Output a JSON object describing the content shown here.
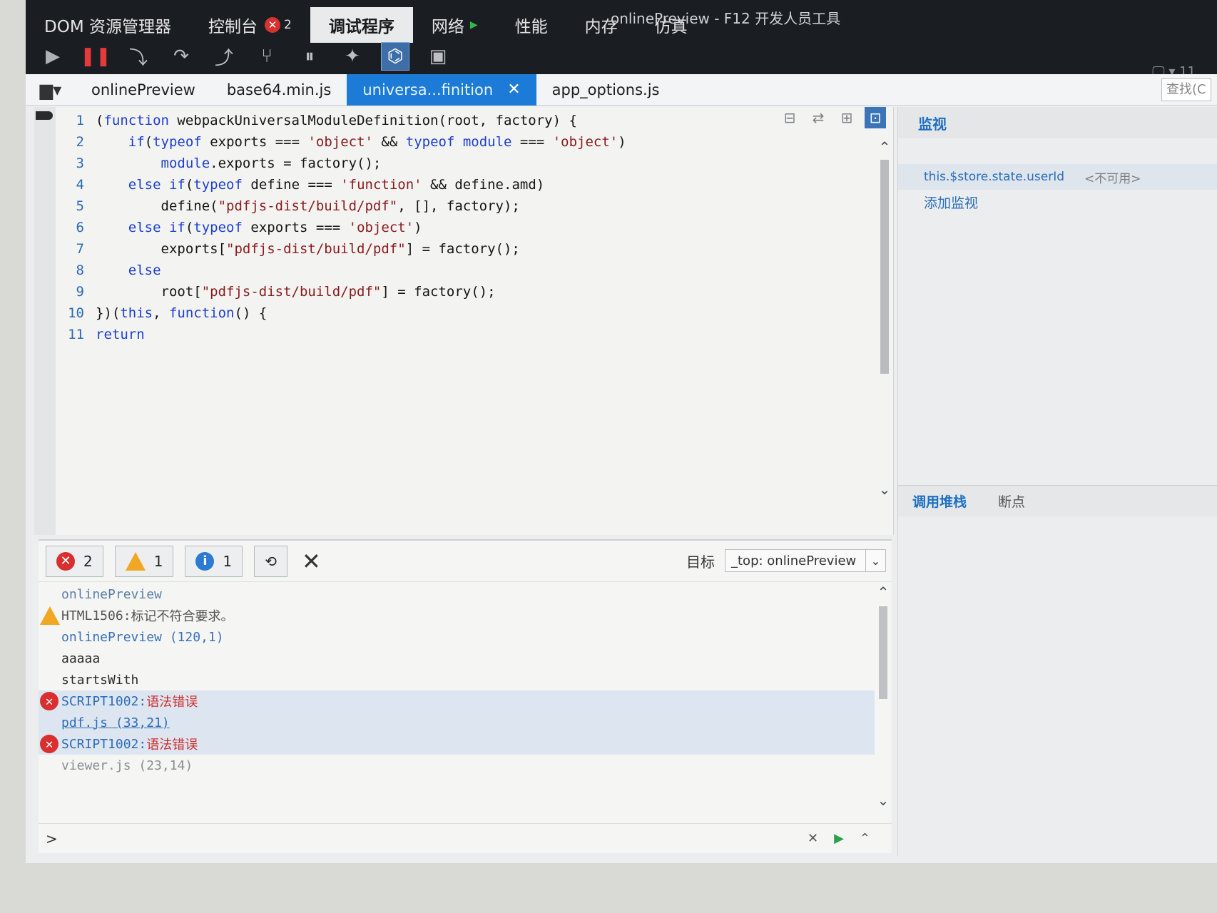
{
  "window_title": "onlinePreview - F12 开发人员工具",
  "right_meta": "11",
  "main_tabs": [
    {
      "label": "DOM 资源管理器"
    },
    {
      "label": "控制台",
      "badge": "✕",
      "badge_count": "2"
    },
    {
      "label": "调试程序"
    },
    {
      "label": "网络"
    },
    {
      "label": "性能"
    },
    {
      "label": "内存"
    },
    {
      "label": "仿真"
    }
  ],
  "file_tabs": [
    "onlinePreview",
    "base64.min.js",
    "universa...finition",
    "app_options.js"
  ],
  "find_placeholder": "查找(C",
  "code_lines": [
    {
      "n": "1",
      "html": "(<span class='kw'>function</span> webpackUniversalModuleDefinition(root, factory) {"
    },
    {
      "n": "2",
      "html": "    <span class='kw'>if</span>(<span class='kw'>typeof</span> exports === <span class='str'>'object'</span> &amp;&amp; <span class='kw'>typeof</span> <span class='kw'>module</span> === <span class='str'>'object'</span>)"
    },
    {
      "n": "3",
      "html": "        <span class='kw'>module</span>.exports = factory();"
    },
    {
      "n": "4",
      "html": "    <span class='kw'>else if</span>(<span class='kw'>typeof</span> define === <span class='str'>'function'</span> &amp;&amp; define.amd)"
    },
    {
      "n": "5",
      "html": "        define(<span class='str'>\"pdfjs-dist/build/pdf\"</span>, [], factory);"
    },
    {
      "n": "6",
      "html": "    <span class='kw'>else if</span>(<span class='kw'>typeof</span> exports === <span class='str'>'object'</span>)"
    },
    {
      "n": "7",
      "html": "        exports[<span class='str'>\"pdfjs-dist/build/pdf\"</span>] = factory();"
    },
    {
      "n": "8",
      "html": "    <span class='kw'>else</span>"
    },
    {
      "n": "9",
      "html": "        root[<span class='str'>\"pdfjs-dist/build/pdf\"</span>] = factory();"
    },
    {
      "n": "10",
      "html": "})(<span class='kw'>this</span>, <span class='kw'>function</span>() {"
    },
    {
      "n": "11",
      "html": "<span class='kw'>return</span>"
    }
  ],
  "watch": {
    "header": "监视",
    "expr": "this.$store.state.userId",
    "value": "<不可用>",
    "add": "添加监视"
  },
  "right_tabs": [
    "调用堆栈",
    "断点"
  ],
  "console": {
    "error_count": "2",
    "warn_count": "1",
    "info_count": "1",
    "target_label": "目标",
    "target_value": "_top: onlinePreview",
    "rows": [
      {
        "type": "first",
        "text": "onlinePreview"
      },
      {
        "type": "warn",
        "code": "HTML1506:",
        "msg": "标记不符合要求。"
      },
      {
        "type": "src",
        "text": "onlinePreview (120,1)"
      },
      {
        "type": "plain",
        "text": "aaaaa"
      },
      {
        "type": "plain",
        "text": "startsWith"
      },
      {
        "type": "error",
        "code": "SCRIPT1002:",
        "msg": "语法错误"
      },
      {
        "type": "link",
        "text": "pdf.js (33,21)"
      },
      {
        "type": "error",
        "code": "SCRIPT1002:",
        "msg": "语法错误"
      },
      {
        "type": "src-faint",
        "text": "viewer.js (23,14)"
      }
    ],
    "prompt": ">"
  }
}
